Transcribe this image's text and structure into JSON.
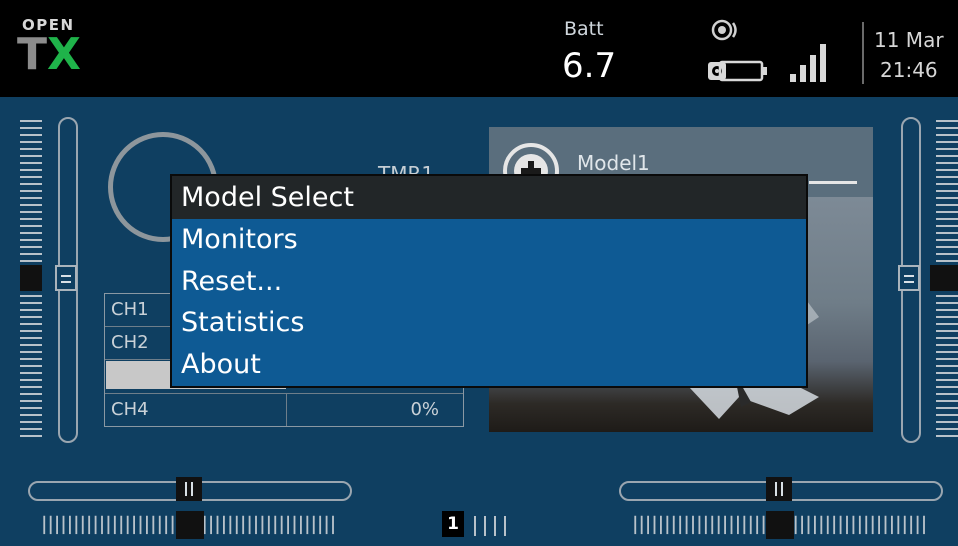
{
  "logo": {
    "top": "OPEN",
    "t": "T",
    "x": "X"
  },
  "status": {
    "batt_label": "Batt",
    "batt_value": "6.7",
    "date": "11 Mar",
    "time": "21:46"
  },
  "timer": {
    "label": "TMR1"
  },
  "channels": [
    {
      "name": "CH1",
      "value": ""
    },
    {
      "name": "CH2",
      "value": ""
    },
    {
      "name": "",
      "value": ""
    },
    {
      "name": "CH4",
      "value": "0%"
    }
  ],
  "model": {
    "name": "Model1"
  },
  "menu": {
    "title": "Model Select",
    "items": [
      "Monitors",
      "Reset...",
      "Statistics",
      "About"
    ]
  },
  "flight_mode": "1",
  "icons": {
    "ear": "ear-icon",
    "battery": "battery-icon",
    "signal": "signal-strength-icon",
    "model": "plus-circle-icon"
  },
  "colors": {
    "background": "#0f3f61",
    "menu": "#0e5a94",
    "menu_title": "#222628",
    "logo_x": "#1fb34a"
  }
}
